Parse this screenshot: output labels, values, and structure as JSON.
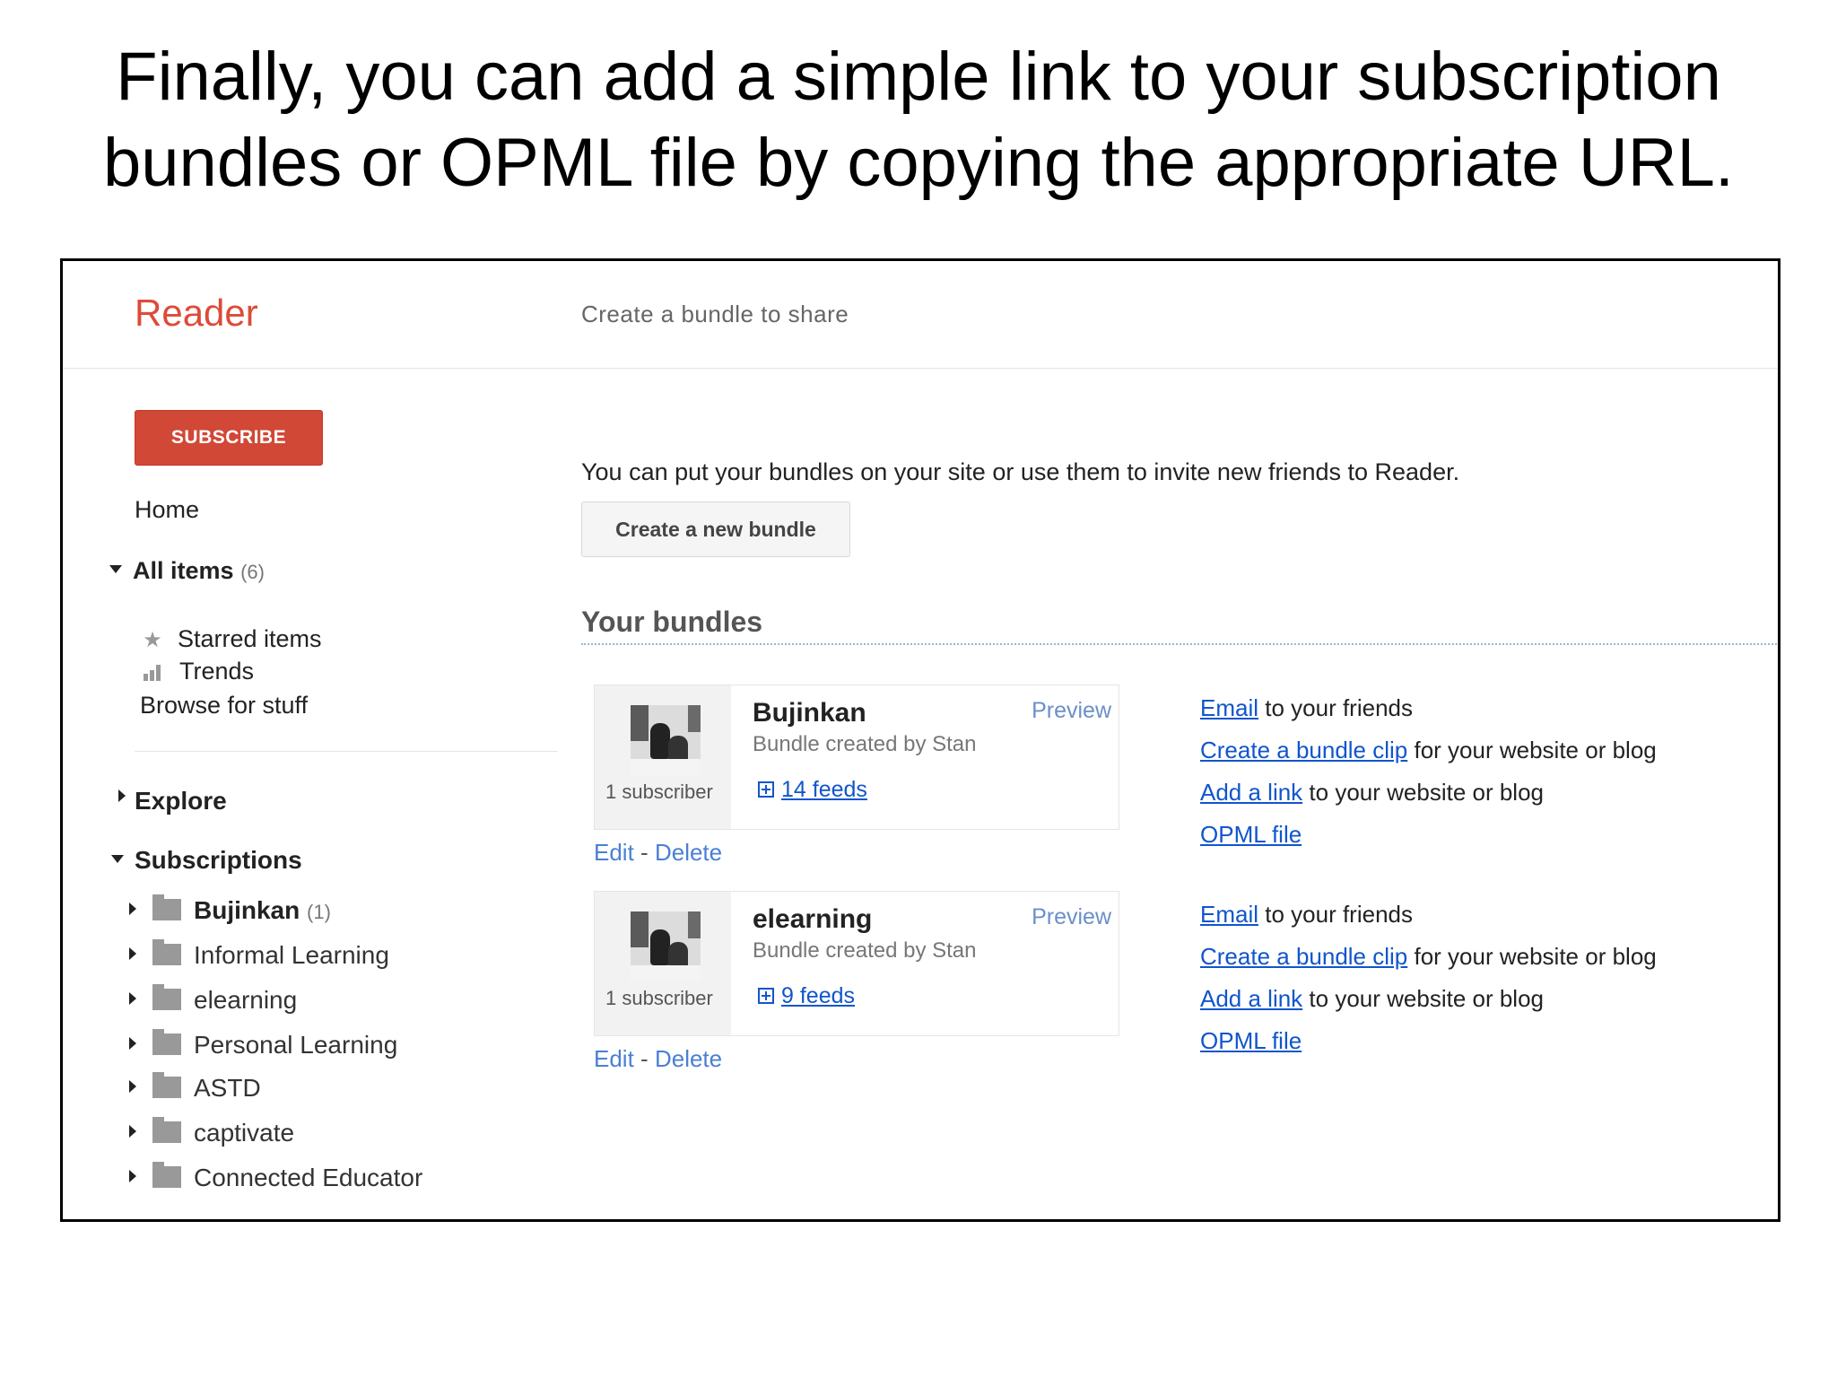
{
  "caption": {
    "line1": "Finally, you can add a simple link to your subscription",
    "line2": "bundles or OPML file by copying the appropriate URL."
  },
  "app": {
    "logo": "Reader",
    "page_header": "Create a bundle to share"
  },
  "sidebar": {
    "subscribe_label": "SUBSCRIBE",
    "home": "Home",
    "all_items": {
      "label": "All items",
      "count": "(6)"
    },
    "starred": "Starred items",
    "trends": "Trends",
    "browse": "Browse for stuff",
    "explore": "Explore",
    "subscriptions": "Subscriptions",
    "folders": [
      {
        "label": "Bujinkan",
        "count": "(1)"
      },
      {
        "label": "Informal Learning"
      },
      {
        "label": "elearning"
      },
      {
        "label": "Personal Learning"
      },
      {
        "label": "ASTD"
      },
      {
        "label": "captivate"
      },
      {
        "label": "Connected Educator"
      }
    ]
  },
  "main": {
    "intro": "You can put your bundles on your site or use them to invite new friends to Reader.",
    "create_bundle_label": "Create a new bundle",
    "section_title": "Your bundles",
    "edit_label": "Edit",
    "separator": "-",
    "delete_label": "Delete",
    "bundles": [
      {
        "title": "Bujinkan",
        "created_by": "Bundle created by Stan",
        "preview": "Preview",
        "subscribers": "1 subscriber",
        "feeds": "14 feeds",
        "share": [
          {
            "link": "Email",
            "rest": " to your friends"
          },
          {
            "link": "Create a bundle clip",
            "rest": " for your website or blog"
          },
          {
            "link": "Add a link",
            "rest": " to your website or blog"
          },
          {
            "link": "OPML file",
            "rest": ""
          }
        ]
      },
      {
        "title": "elearning",
        "created_by": "Bundle created by Stan",
        "preview": "Preview",
        "subscribers": "1 subscriber",
        "feeds": "9 feeds",
        "share": [
          {
            "link": "Email",
            "rest": " to your friends"
          },
          {
            "link": "Create a bundle clip",
            "rest": " for your website or blog"
          },
          {
            "link": "Add a link",
            "rest": " to your website or blog"
          },
          {
            "link": "OPML file",
            "rest": ""
          }
        ]
      }
    ]
  },
  "colors": {
    "brand_red": "#dd4b39",
    "subscribe_red": "#d14836",
    "link_blue": "#1155cc",
    "preview_blue": "#6b8fc9"
  }
}
